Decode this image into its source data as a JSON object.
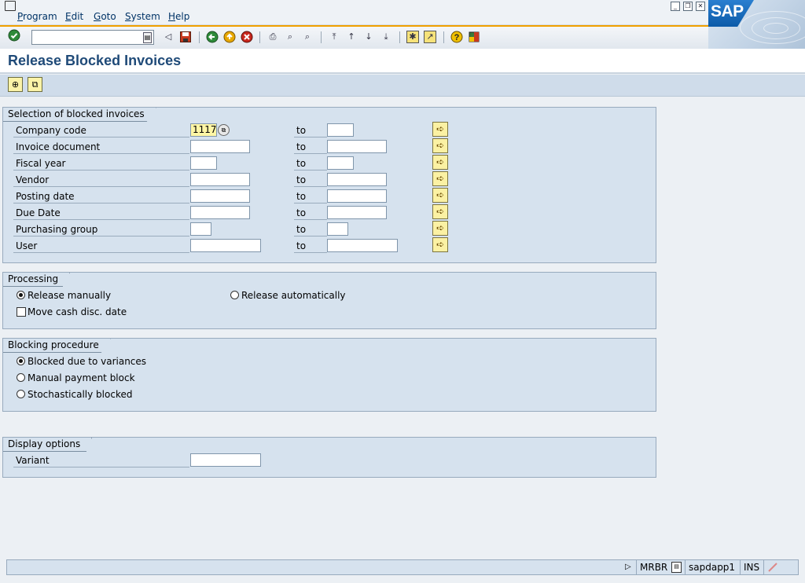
{
  "menu": {
    "items": [
      "Program",
      "Edit",
      "Goto",
      "System",
      "Help"
    ]
  },
  "brand": {
    "logo_text": "SAP",
    "accent_color": "#f0a000"
  },
  "toolbar": {
    "command_field_value": "",
    "icons": [
      "enter-icon",
      "back-arrow-icon",
      "save-icon",
      "back-icon",
      "exit-icon",
      "cancel-icon",
      "print-icon",
      "find-icon",
      "find-next-icon",
      "first-page-icon",
      "previous-page-icon",
      "next-page-icon",
      "last-page-icon",
      "create-session-icon",
      "shortcut-icon",
      "help-icon",
      "layout-menu-icon"
    ]
  },
  "page": {
    "title": "Release Blocked Invoices"
  },
  "app_toolbar": {
    "buttons": [
      "execute-icon",
      "get-variant-icon"
    ]
  },
  "selection": {
    "title": "Selection of blocked invoices",
    "to_label": "to",
    "rows": [
      {
        "label": "Company code",
        "from": "1117",
        "to": ""
      },
      {
        "label": "Invoice document",
        "from": "",
        "to": ""
      },
      {
        "label": "Fiscal year",
        "from": "",
        "to": ""
      },
      {
        "label": "Vendor",
        "from": "",
        "to": ""
      },
      {
        "label": "Posting date",
        "from": "",
        "to": ""
      },
      {
        "label": "Due Date",
        "from": "",
        "to": ""
      },
      {
        "label": "Purchasing group",
        "from": "",
        "to": ""
      },
      {
        "label": "User",
        "from": "",
        "to": ""
      }
    ]
  },
  "processing": {
    "title": "Processing",
    "release_manually": "Release manually",
    "release_manually_selected": true,
    "release_automatically": "Release automatically",
    "move_cash_disc": "Move cash disc. date",
    "move_cash_disc_checked": false
  },
  "blocking": {
    "title": "Blocking procedure",
    "options": [
      "Blocked due to variances",
      "Manual payment block",
      "Stochastically blocked"
    ],
    "selected_index": 0
  },
  "display": {
    "title": "Display options",
    "variant_label": "Variant",
    "variant_value": ""
  },
  "status": {
    "transaction": "MRBR",
    "server": "sapdapp1",
    "mode": "INS"
  }
}
